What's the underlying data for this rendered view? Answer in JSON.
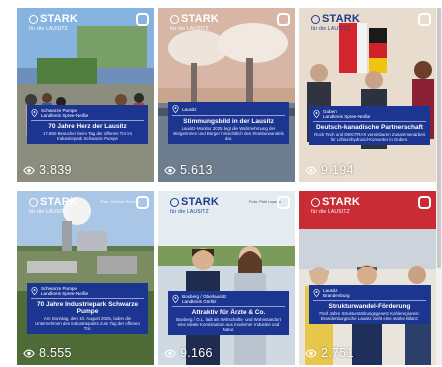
{
  "tiles": [
    {
      "brand": "STARK",
      "brand_sub": "für die LAUSITZ",
      "credit": "Foto: Steffen Rasche",
      "location": [
        "Schwarze Pumpe",
        "Landkreis Spree-Neiße"
      ],
      "title": "70 Jahre Herz der Lausitz",
      "text": "17.850 Besucher beim Tag der offenen Tür im Industriepark Schwarze Pumpe",
      "views": "3.839",
      "logo_style": "light"
    },
    {
      "brand": "STARK",
      "brand_sub": "für die LAUSITZ",
      "credit": "Foto: LEAG",
      "location": [
        "Lausitz"
      ],
      "title": "Stimmungsbild in der Lausitz",
      "text": "Lausitz-Monitor 2025 legt die Wahrnehmung der Bürgerinnen und Bürger hinsichtlich des Strukturwandels dar.",
      "views": "5.613",
      "logo_style": "light"
    },
    {
      "brand": "STARK",
      "brand_sub": "für die LAUSITZ",
      "credit": "Foto: Stadt Guben",
      "location": [
        "Guben",
        "Landkreis Spree-Neiße"
      ],
      "title": "Deutsch-kanadische Partnerschaft",
      "text": "Rock Tech und DEKITRAS vereinbaren Zusammenarbeit für Lithiumhydroxid-Konverter in Guben.",
      "views": "9.194",
      "logo_style": "dark"
    },
    {
      "brand": "STARK",
      "brand_sub": "für die LAUSITZ",
      "credit": "Foto: Dietmar Brucher",
      "location": [
        "Schwarze Pumpe",
        "Landkreis Spree-Neiße"
      ],
      "title": "70 Jahre Industriepark Schwarze Pumpe",
      "text": "Am Sonntag, den 10. August 2025, laden die Unternehmen des Industrieparks zum Tag der offenen Tür.",
      "views": "8.555",
      "logo_style": "light"
    },
    {
      "brand": "STARK",
      "brand_sub": "für die LAUSITZ",
      "credit": "Foto: Pohl Lausitz",
      "location": [
        "Boxberg / Oberlausitz",
        "Landkreis Görlitz"
      ],
      "title": "Attraktiv für Ärzte & Co.",
      "text": "Boxberg / O.L. lädt als Wirtschafts- und Wohnstandort eine ideale Kombination aus moderner Industrie und Natur.",
      "views": "9.166",
      "logo_style": "dark"
    },
    {
      "brand": "STARK",
      "brand_sub": "für die LAUSITZ",
      "credit": "Foto: LEAG/Bundesregierung",
      "location": [
        "Lausitz",
        "Brandenburg"
      ],
      "title": "Strukturwandel-Förderung",
      "text": "Fünf Jahre Strukturstärkungsgesetz Kohleregionen: Brandenburgische Lausitz zieht eine starke Bilanz",
      "views": "2.751",
      "logo_style": "dark"
    }
  ],
  "colors": {
    "card_blue": "#1c3591",
    "brand_blue": "#1f3c8c"
  }
}
